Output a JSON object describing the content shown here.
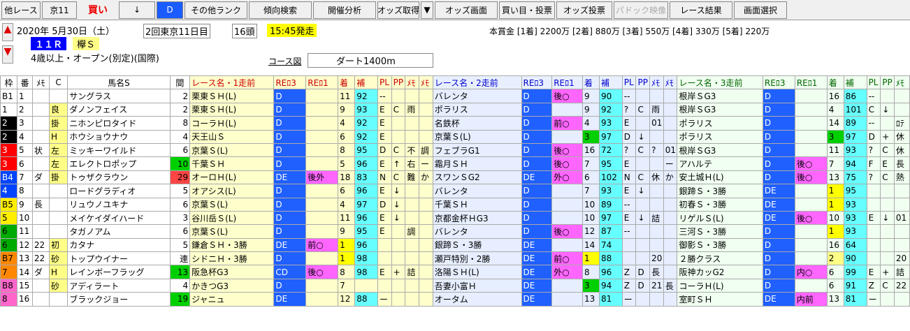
{
  "toolbar": {
    "items": [
      "他レース",
      "京11",
      "買い",
      "↓",
      "D",
      "その他ランク",
      "傾向検索",
      "開催分析",
      "オッズ取得",
      "▼",
      "オッズ画面",
      "買い目・投票",
      "オッズ投票",
      "パドック映像",
      "レース結果",
      "画面選択"
    ]
  },
  "race": {
    "date": "2020年  5月30日（土）",
    "kai": "2回東京11日目",
    "heads": "16頭",
    "start": "15:45発走",
    "r": "１１Ｒ",
    "name": "欅Ｓ",
    "cond": "4歳以上・オープン(別定)(国際)",
    "prize": "本賞金 [1着] 2200万 [2着] 880万 [3着] 550万 [4着] 330万 [5着] 220万",
    "course_label": "コース図",
    "course": "ダート1400m"
  },
  "headers": [
    "枠",
    "番",
    "ﾒﾓ",
    "C",
    "馬名S",
    "間",
    "レース名・1走前",
    "REﾛ3",
    "REﾛ1",
    "着",
    "補",
    "PL",
    "PP",
    "ﾒﾓ",
    "ﾒﾓ",
    "レース名・2走前",
    "REﾛ3",
    "REﾛ1",
    "着",
    "補",
    "PL",
    "PP",
    "ﾒﾓ",
    "ﾒﾓ",
    "レース名・3走前",
    "REﾛ3",
    "REﾛ1",
    "着",
    "補",
    "PL",
    "PP",
    "ﾒﾓ"
  ],
  "rows": [
    [
      "B1",
      "1",
      "",
      "",
      "サングラス",
      "2",
      "栗東ＳＨ(L)",
      "D",
      "",
      "11",
      "92",
      "--",
      "",
      "",
      "",
      "バレンタ",
      "D",
      "後○",
      "9",
      "90",
      "--",
      "",
      "",
      "",
      "根岸ＳG3",
      "D",
      "",
      "16",
      "86",
      "--",
      "",
      ""
    ],
    [
      "1",
      "2",
      "",
      "良",
      "ダノンフェイス",
      "2",
      "栗東ＳＨ(L)",
      "D",
      "",
      "9",
      "93",
      "E",
      "C",
      "雨",
      "",
      "ポラリス",
      "D",
      "",
      "9",
      "92",
      "?",
      "C",
      "雨",
      "",
      "根岸ＳG3",
      "D",
      "",
      "4",
      "101",
      "C",
      "↓",
      ""
    ],
    [
      "2",
      "3",
      "",
      "掛",
      "ニホンピロタイド",
      "8",
      "コーラＨ(L)",
      "D",
      "",
      "4",
      "92",
      "E",
      "",
      "",
      "",
      "名鉄杯",
      "D",
      "前○",
      "4",
      "93",
      "E",
      "",
      "01",
      "",
      "ポラリス",
      "D",
      "",
      "14",
      "89",
      "--",
      "",
      "ﾛﾃ"
    ],
    [
      "2",
      "4",
      "",
      "H",
      "ホウショウナウ",
      "4",
      "天王山Ｓ",
      "D",
      "",
      "6",
      "92",
      "E",
      "",
      "",
      "",
      "京葉Ｓ(L)",
      "D",
      "",
      "3",
      "97",
      "D",
      "↓",
      "",
      "",
      "ポラリス",
      "D",
      "",
      "3",
      "97",
      "D",
      "+",
      "休"
    ],
    [
      "3",
      "5",
      "状",
      "左",
      "ミッキーワイルド",
      "6",
      "京葉Ｓ(L)",
      "D",
      "",
      "8",
      "95",
      "D",
      "C",
      "不",
      "調",
      "フェブラG1",
      "D",
      "後○",
      "16",
      "72",
      "?",
      "C",
      "?",
      "01",
      "根岸ＳG3",
      "D",
      "",
      "11",
      "93",
      "?",
      "C",
      "休"
    ],
    [
      "3",
      "6",
      "",
      "左",
      "エレクトロポップ",
      "10",
      "千葉ＳＨ",
      "D",
      "",
      "5",
      "96",
      "E",
      "↑",
      "右",
      "ー",
      "霜月ＳＨ",
      "D",
      "後○",
      "7",
      "95",
      "E",
      "",
      "",
      "ー",
      "アハルテ",
      "D",
      "後○",
      "7",
      "94",
      "F",
      "E",
      "長"
    ],
    [
      "B4",
      "7",
      "ダ",
      "掛",
      "トゥザクラウン",
      "29",
      "オーロＨ(L)",
      "DE",
      "後外",
      "18",
      "83",
      "N",
      "C",
      "難",
      "か",
      "スワンＳG2",
      "DE",
      "外○",
      "6",
      "102",
      "N",
      "C",
      "休",
      "か",
      "安土城Ｈ(L)",
      "D",
      "後○",
      "13",
      "75",
      "?",
      "C",
      "熱"
    ],
    [
      "4",
      "8",
      "",
      "",
      "ロードグラディオ",
      "5",
      "オアシス(L)",
      "D",
      "",
      "6",
      "96",
      "E",
      "↓",
      "",
      "",
      "バレンタ",
      "D",
      "",
      "7",
      "93",
      "E",
      "↓",
      "",
      "",
      "銀蹄Ｓ・3勝",
      "DE",
      "",
      "1",
      "95",
      "",
      "",
      ""
    ],
    [
      "B5",
      "9",
      "長",
      "",
      "リュウノユキナ",
      "6",
      "京葉Ｓ(L)",
      "D",
      "",
      "4",
      "97",
      "D",
      "↓",
      "",
      "",
      "千葉ＳＨ",
      "D",
      "",
      "10",
      "89",
      "--",
      "",
      "",
      "",
      "初春Ｓ・3勝",
      "DE",
      "",
      "1",
      "93",
      "",
      "",
      ""
    ],
    [
      "5",
      "10",
      "",
      "",
      "メイケイダイハード",
      "3",
      "谷川岳Ｓ(L)",
      "D",
      "",
      "11",
      "96",
      "E",
      "↓",
      "",
      "",
      "京都金杯ＨG3",
      "D",
      "",
      "10",
      "97",
      "E",
      "↓",
      "詰",
      "",
      "リゲルＳ(L)",
      "DE",
      "後○",
      "10",
      "93",
      "E",
      "↓",
      "01"
    ],
    [
      "6",
      "11",
      "",
      "",
      "タガノアム",
      "6",
      "京葉Ｓ(L)",
      "D",
      "",
      "9",
      "95",
      "E",
      "",
      "調",
      "",
      "バレンタ",
      "D",
      "後○",
      "12",
      "87",
      "--",
      "",
      "",
      "",
      "三河Ｓ・3勝",
      "D",
      "",
      "1",
      "93",
      "",
      "",
      ""
    ],
    [
      "6",
      "12",
      "22",
      "初",
      "カタナ",
      "5",
      "鎌倉ＳＨ・3勝",
      "DE",
      "前○",
      "1",
      "96",
      "",
      "",
      "",
      "",
      "銀蹄Ｓ・3勝",
      "DE",
      "",
      "14",
      "74",
      "",
      "",
      "",
      "",
      "御影Ｓ・3勝",
      "D",
      "",
      "16",
      "64",
      "",
      "",
      ""
    ],
    [
      "B7",
      "13",
      "22",
      "砂",
      "トップウイナー",
      "連",
      "シドニＨ・3勝",
      "D",
      "",
      "1",
      "98",
      "",
      "",
      "",
      "",
      "瀬戸特別・2勝",
      "DE",
      "前○",
      "1",
      "88",
      "",
      "",
      "20",
      "",
      "２勝クラス",
      "D",
      "",
      "2",
      "90",
      "",
      "",
      "20"
    ],
    [
      "7",
      "14",
      "ダ",
      "H",
      "レインボーフラッグ",
      "13",
      "阪急杯G3",
      "CD",
      "後○",
      "8",
      "98",
      "E",
      "+",
      "詰",
      "",
      "洛陽ＳＨ(L)",
      "DE",
      "外○",
      "8",
      "96",
      "Z",
      "D",
      "長",
      "",
      "阪神カッG2",
      "D",
      "内○",
      "6",
      "99",
      "E",
      "+",
      "詰"
    ],
    [
      "B8",
      "15",
      "",
      "砂",
      "アディラート",
      "4",
      "かきつG3",
      "D",
      "",
      "7",
      "",
      "",
      "",
      "",
      "",
      "吾妻小富Ｈ",
      "DE",
      "",
      "3",
      "94",
      "Z",
      "D",
      "21",
      "長",
      "コーラＨ(L)",
      "D",
      "",
      "6",
      "91",
      "Z",
      "C",
      "22"
    ],
    [
      "8",
      "16",
      "",
      "",
      "ブラックジョー",
      "19",
      "ジャニュ",
      "DE",
      "",
      "12",
      "88",
      "ー",
      "",
      "",
      "",
      "オータム",
      "DE",
      "",
      "13",
      "81",
      "ー",
      "",
      "",
      "",
      "室町ＳＨ",
      "DE",
      "内前",
      "13",
      "81",
      "ー",
      "",
      ""
    ]
  ],
  "colors": {
    "waku": [
      "#ffffff",
      "#000000",
      "#ff0000",
      "#0044ff",
      "#ffee00",
      "#00aa00",
      "#ff8800",
      "#ff66cc"
    ]
  }
}
